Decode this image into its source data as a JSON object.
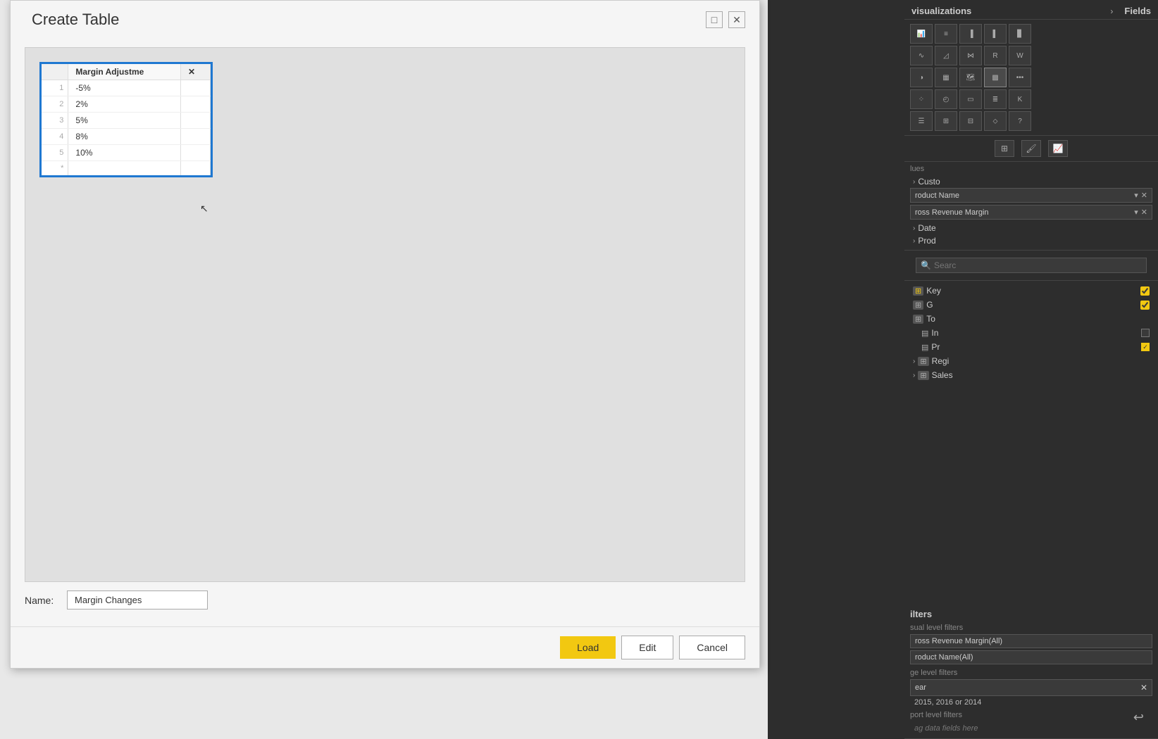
{
  "dialog": {
    "title": "Create Table",
    "minimize_label": "□",
    "close_label": "✕"
  },
  "table": {
    "column_header": "Margin Adjustme",
    "empty_header": "",
    "rows": [
      {
        "num": "1",
        "value": "-5%"
      },
      {
        "num": "2",
        "value": "2%"
      },
      {
        "num": "3",
        "value": "5%"
      },
      {
        "num": "4",
        "value": "8%"
      },
      {
        "num": "5",
        "value": "10%"
      },
      {
        "num": "*",
        "value": ""
      }
    ]
  },
  "name_field": {
    "label": "Name:",
    "value": "Margin Changes",
    "placeholder": ""
  },
  "footer": {
    "load_label": "Load",
    "edit_label": "Edit",
    "cancel_label": "Cancel"
  },
  "right_panel": {
    "viz_header": "visualizations",
    "fields_header": "Fields",
    "search_placeholder": "Searc",
    "sections": {
      "custom_label": "Custo",
      "date_label": "Date",
      "product_label": "Prod",
      "region_label": "Regi",
      "sales_label": "Sales"
    },
    "values_label": "lues",
    "product_name_field": "roduct Name",
    "gross_revenue_field": "ross Revenue Margin",
    "filters_title": "ilters",
    "visual_level_label": "sual level filters",
    "gross_revenue_filter": "ross Revenue Margin(All)",
    "product_name_filter": "roduct Name(All)",
    "page_level_label": "ge level filters",
    "year_filter_label": "ear",
    "year_filter_value": "2015, 2016 or 2014",
    "report_level_label": "port level filters",
    "drag_label": "ag data fields here",
    "fields": [
      {
        "label": "Key",
        "checked": true,
        "icon": "key"
      },
      {
        "label": "G",
        "checked": true
      },
      {
        "label": "To",
        "checked": false
      },
      {
        "label": "In",
        "checked": false
      },
      {
        "label": "Pr",
        "checked": true
      }
    ]
  },
  "viz_icons": [
    "bar-chart",
    "table",
    "column-chart",
    "matrix",
    "100pct-bar",
    "map",
    "filled-map",
    "donut",
    "treemap",
    "combo",
    "pie",
    "scatter",
    "gauge",
    "kpi",
    "funnel",
    "line",
    "area",
    "waterfall",
    "ribbon",
    "more",
    "slicer",
    "card",
    "multi-row-card",
    "q-and-a"
  ]
}
